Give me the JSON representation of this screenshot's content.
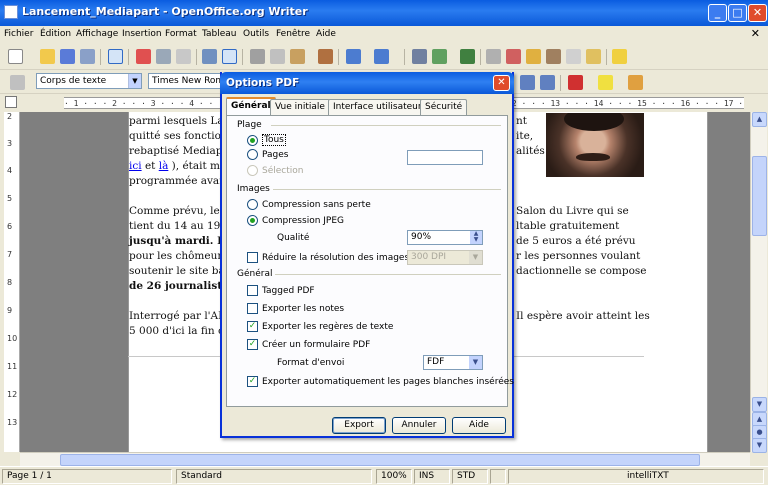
{
  "window": {
    "title": "Lancement_Mediapart - OpenOffice.org Writer",
    "buttons": [
      "_",
      "□",
      "✕"
    ]
  },
  "menu": [
    "Fichier",
    "Édition",
    "Affichage",
    "Insertion",
    "Format",
    "Tableau",
    "Outils",
    "Fenêtre",
    "Aide"
  ],
  "formatting": {
    "style": "Corps de texte",
    "font": "Times New Roman"
  },
  "ruler": {
    "ticks": "· 1 · · · 2 · · · 3 · · · 4 · · · 5 · · · 6 · · · 7 · · · 8 · · · 9 · · · 10 · · · 11 · · · 12 · · · 13 · · · 14 · · · 15 · · · 16 · · · 17 · · · 18",
    "vticks": [
      "2",
      "3",
      "4",
      "5",
      "6",
      "7",
      "8",
      "9",
      "10",
      "11",
      "12",
      "13"
    ]
  },
  "document": {
    "lines": [
      {
        "a": "parmi lesquels La",
        "b": "nt"
      },
      {
        "a": "quitté ses fonction",
        "b": "ite,"
      },
      {
        "a": "rebaptisé Mediap",
        "b": "alités"
      },
      {
        "link1": "ici",
        "mid": " et ",
        "link2": "là",
        "a": " ), était mi"
      },
      {
        "a": "programmée avan"
      },
      {
        "a": "Comme prévu, le",
        "b": "Salon du Livre qui se"
      },
      {
        "a": "tient du 14 au 19 r",
        "b": "ltable gratuitement"
      },
      {
        "a": "jusqu'à mardi. E",
        "b": "de 5 euros a été prévu"
      },
      {
        "a": "pour les chômeurs",
        "b": "r les personnes voulant"
      },
      {
        "a": "soutenir le site ba",
        "b": "dactionnelle se compose"
      },
      {
        "a": "de 26 journaliste"
      },
      {
        "a": "Interrogé par l'AF",
        "b": "Il espère avoir atteint les"
      },
      {
        "a": "5 000 d'ici la fin  c"
      }
    ]
  },
  "dialog": {
    "title": "Options PDF",
    "tabs": [
      "Général",
      "Vue initiale",
      "Interface utilisateur",
      "Sécurité"
    ],
    "plage": {
      "label": "Plage",
      "tous": "Tous",
      "pages": "Pages",
      "selection": "Sélection"
    },
    "images": {
      "label": "Images",
      "sans_perte": "Compression sans perte",
      "jpeg": "Compression JPEG",
      "qualite": "Qualité",
      "qualite_value": "90%",
      "reduire": "Réduire la résolution des images",
      "dpi": "300 DPI"
    },
    "general": {
      "label": "Général",
      "tagged": "Tagged PDF",
      "notes": "Exporter les notes",
      "regeres": "Exporter les regères de texte",
      "formulaire": "Créer un formulaire PDF",
      "format_envoi": "Format d'envoi",
      "format_value": "FDF",
      "pages_blanches": "Exporter automatiquement les pages blanches insérées"
    },
    "buttons": {
      "export": "Export",
      "annuler": "Annuler",
      "aide": "Aide"
    }
  },
  "status": {
    "page": "Page 1 / 1",
    "style": "Standard",
    "zoom": "100%",
    "ins": "INS",
    "std": "STD",
    "mode": "intelliTXT"
  }
}
